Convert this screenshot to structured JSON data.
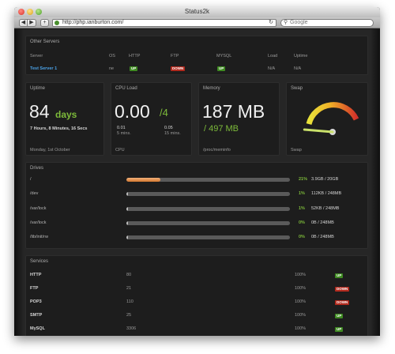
{
  "window": {
    "title": "Status2k",
    "url": "http://php.ianburton.com/",
    "search_placeholder": "Google"
  },
  "servers": {
    "title": "Other Servers",
    "headers": [
      "Server",
      "OS",
      "HTTP",
      "FTP",
      "MYSQL",
      "Load",
      "Uptime"
    ],
    "row": {
      "name": "Test Server 1",
      "os": "ne",
      "http": "UP",
      "ftp": "DOWN",
      "mysql": "UP",
      "load": "N/A",
      "uptime": "N/A"
    }
  },
  "uptime": {
    "title": "Uptime",
    "value": "84",
    "unit": "days",
    "detail": "7 Hours, 8 Minutes, 16 Secs",
    "footer": "Monday, 1st October"
  },
  "cpu": {
    "title": "CPU Load",
    "value": "0.00",
    "cores": "/4",
    "load5": "0.01",
    "load5_label": "5 mins.",
    "load15": "0.05",
    "load15_label": "15 mins.",
    "footer": "CPU"
  },
  "memory": {
    "title": "Memory",
    "value": "187 MB",
    "total": "/ 497 MB",
    "footer": "/proc/meminfo"
  },
  "swap": {
    "title": "Swap",
    "footer": "Swap",
    "gauge_percent": 0.1
  },
  "drives": {
    "title": "Drives",
    "items": [
      {
        "path": "/",
        "percent_label": "21%",
        "percent": 21,
        "usage": "3.9GB / 20GB"
      },
      {
        "path": "/dev",
        "percent_label": "1%",
        "percent": 1,
        "usage": "112KB / 248MB"
      },
      {
        "path": "/var/lock",
        "percent_label": "1%",
        "percent": 1,
        "usage": "52KB / 248MB"
      },
      {
        "path": "/var/lock",
        "percent_label": "0%",
        "percent": 0,
        "usage": "0B / 248MB"
      },
      {
        "path": "/lib/init/rw",
        "percent_label": "0%",
        "percent": 0,
        "usage": "0B / 248MB"
      }
    ]
  },
  "services": {
    "title": "Services",
    "items": [
      {
        "name": "HTTP",
        "port": "80",
        "uptime": "100%",
        "status": "UP"
      },
      {
        "name": "FTP",
        "port": "21",
        "uptime": "100%",
        "status": "DOWN"
      },
      {
        "name": "POP3",
        "port": "110",
        "uptime": "100%",
        "status": "DOWN"
      },
      {
        "name": "SMTP",
        "port": "25",
        "uptime": "100%",
        "status": "UP"
      },
      {
        "name": "MySQL",
        "port": "3306",
        "uptime": "100%",
        "status": "UP"
      }
    ]
  },
  "colors": {
    "accent_green": "#7dbb3a",
    "up": "#3f8a22",
    "down": "#b12a1e",
    "link": "#4ba3e8"
  }
}
